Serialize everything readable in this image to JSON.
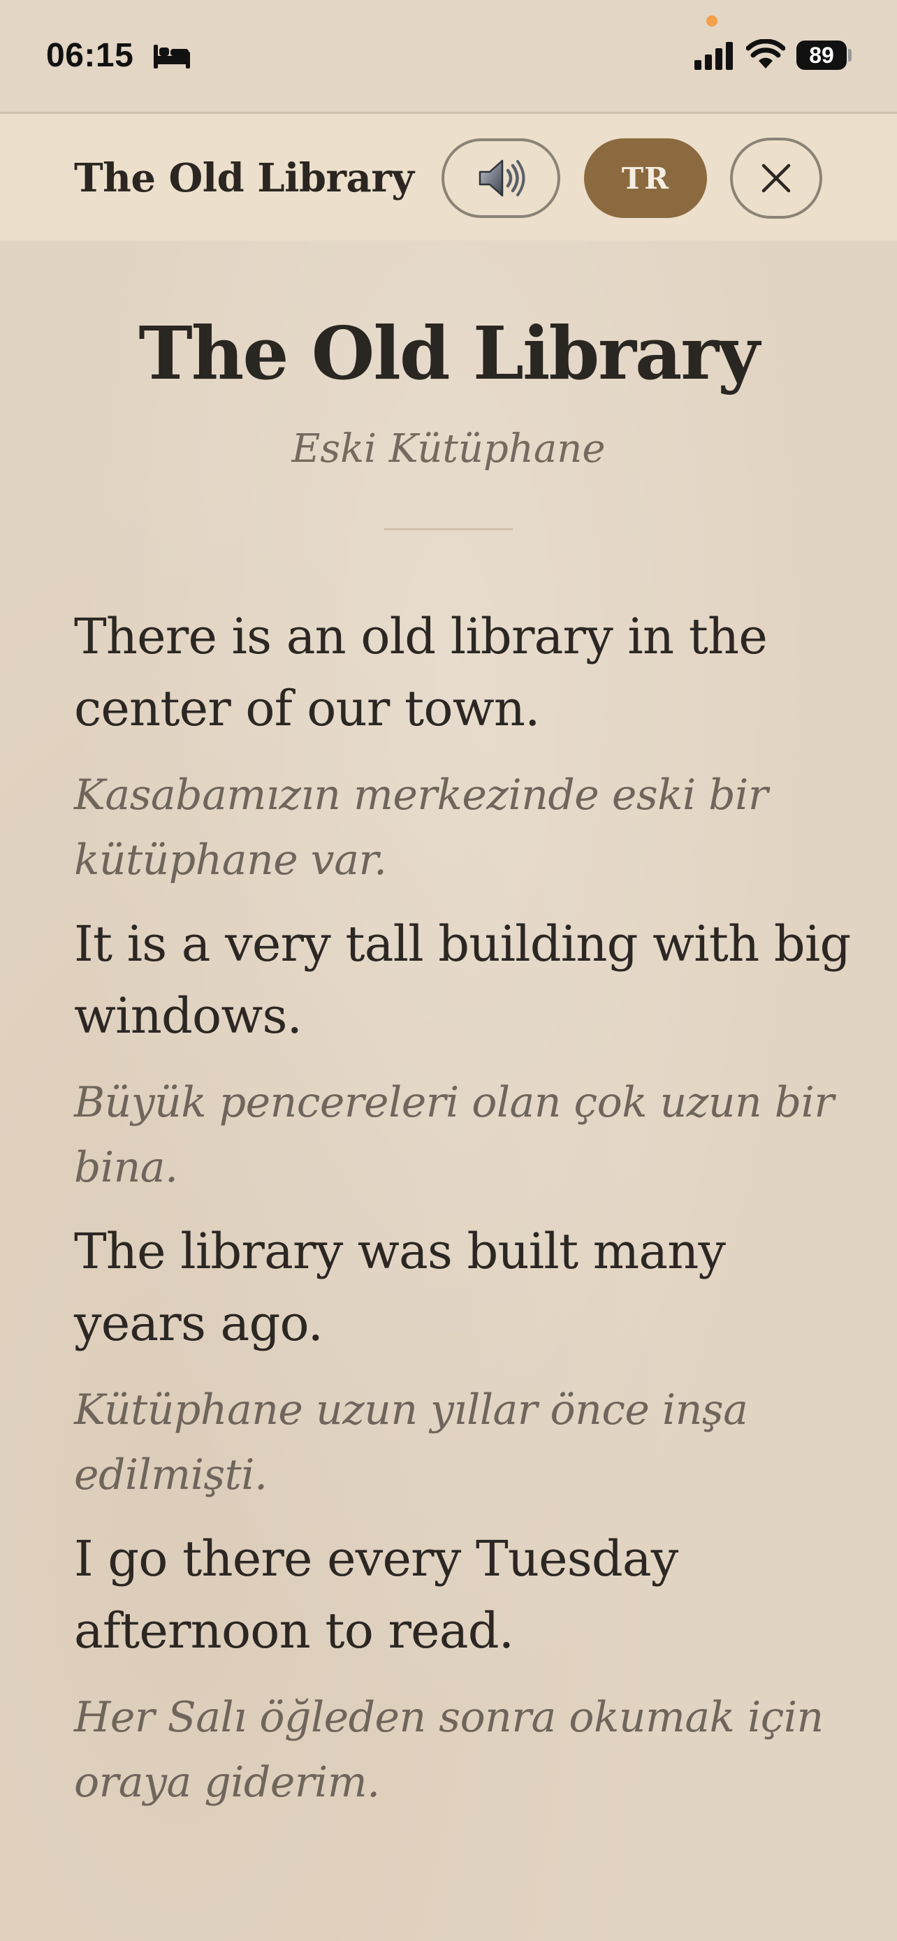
{
  "status_bar": {
    "time": "06:15",
    "battery": "89",
    "icons": [
      "bed-icon",
      "signal-icon",
      "wifi-icon",
      "battery-icon"
    ]
  },
  "header": {
    "title": "The Old Library",
    "audio_icon": "speaker-icon",
    "language_label": "TR",
    "close_icon": "close-icon"
  },
  "story": {
    "title": "The Old Library",
    "subtitle": "Eski Kütüphane",
    "sentences": [
      {
        "en": "There is an old library in the center of our town.",
        "tr": "Kasabamızın merkezinde eski bir kütüphane var."
      },
      {
        "en": "It is a very tall building with big windows.",
        "tr": "Büyük pencereleri olan çok uzun bir bina."
      },
      {
        "en": "The library was built many years ago.",
        "tr": "Kütüphane uzun yıllar önce inşa edilmişti."
      },
      {
        "en": "I go there every Tuesday afternoon to read.",
        "tr": "Her Salı öğleden sonra okumak için oraya giderim."
      }
    ]
  },
  "colors": {
    "background": "#e2d4c2",
    "header_bg": "#ecdfcb",
    "accent": "#8b6a3f",
    "text": "#2c2723",
    "translation_text": "#6f655b"
  }
}
